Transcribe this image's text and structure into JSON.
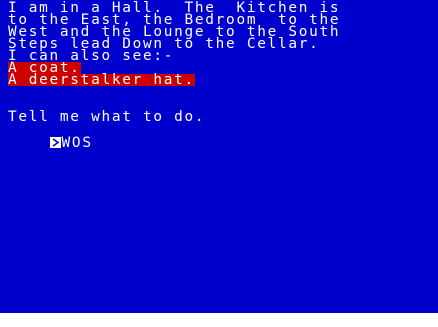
{
  "game": {
    "description": [
      "I am in a Hall.  The  Kitchen is",
      "to the East, the Bedroom  to the",
      "West and the Lounge to the South",
      "Steps lead Down to the Cellar.",
      "I can also see:-"
    ],
    "items": [
      "A coat.",
      "A deerstalker hat."
    ],
    "prompt": "Tell me what to do.",
    "command_input": "WOS",
    "cursor_icon": "cursor-block-icon"
  },
  "colors": {
    "screen_background": "#0000cd",
    "text": "#ffffff",
    "item_highlight": "#cd0000",
    "border": "#ffffff"
  }
}
